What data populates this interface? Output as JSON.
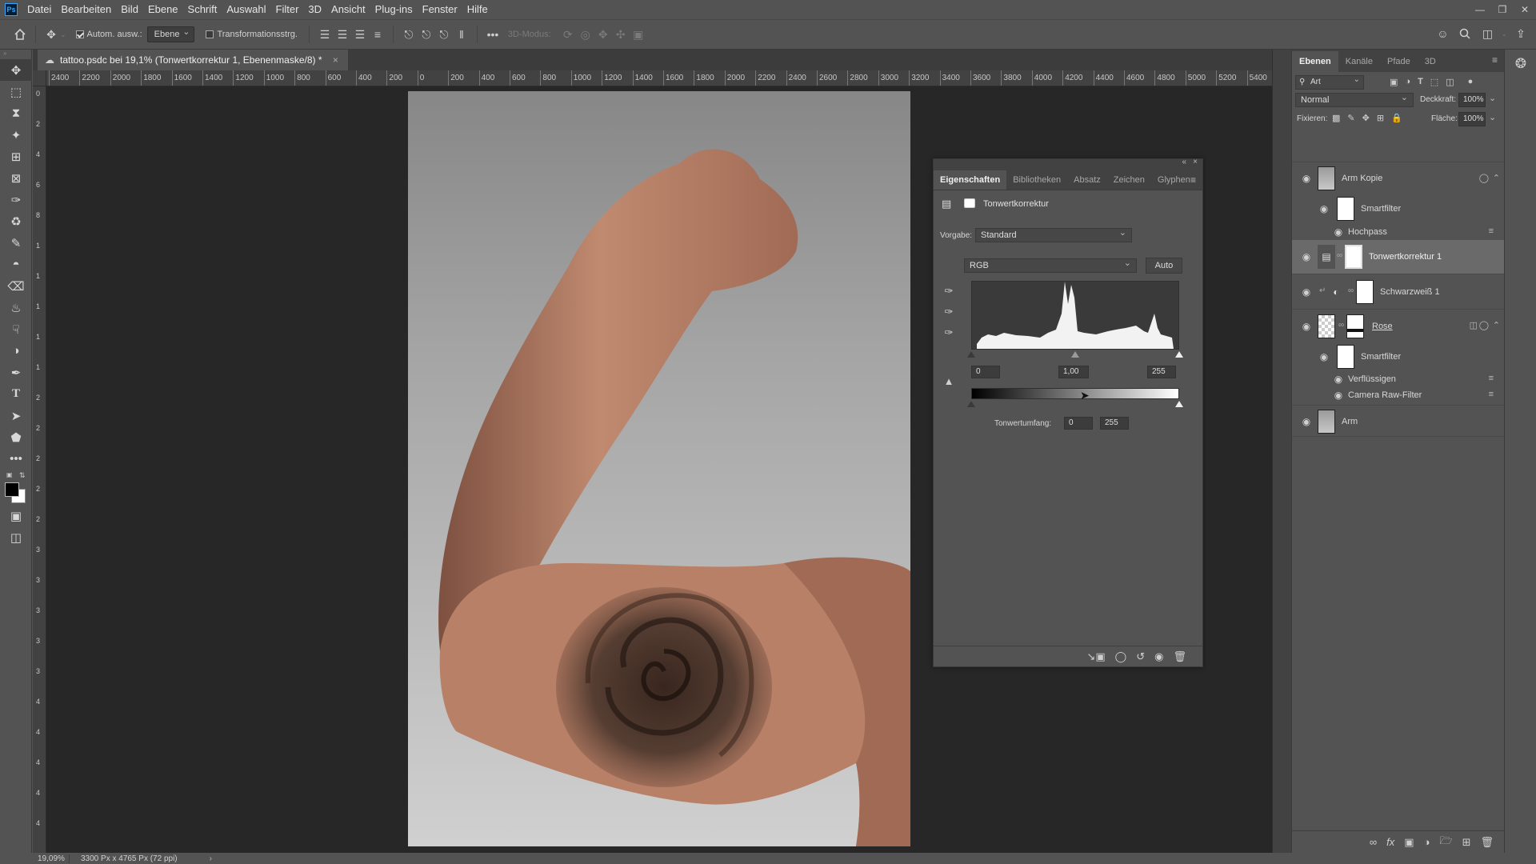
{
  "menu": {
    "logo": "Ps",
    "items": [
      "Datei",
      "Bearbeiten",
      "Bild",
      "Ebene",
      "Schrift",
      "Auswahl",
      "Filter",
      "3D",
      "Ansicht",
      "Plug-ins",
      "Fenster",
      "Hilfe"
    ]
  },
  "options": {
    "auto_select_label": "Autom. ausw.:",
    "auto_select_value": "Ebene",
    "transform_label": "Transformationsstrg.",
    "mode_3d_label": "3D-Modus:"
  },
  "document": {
    "tab_title": "tattoo.psdc bei 19,1% (Tonwertkorrektur 1, Ebenenmaske/8) *"
  },
  "rulers": {
    "horizontal": [
      "2400",
      "2200",
      "2000",
      "1800",
      "1600",
      "1400",
      "1200",
      "1000",
      "800",
      "600",
      "400",
      "200",
      "0",
      "200",
      "400",
      "600",
      "800",
      "1000",
      "1200",
      "1400",
      "1600",
      "1800",
      "2000",
      "2200",
      "2400",
      "2600",
      "2800",
      "3000",
      "3200",
      "3400",
      "3600",
      "3800",
      "4000",
      "4200",
      "4400",
      "4600",
      "4800",
      "5000",
      "5200",
      "5400"
    ],
    "vertical": [
      "0",
      "2",
      "4",
      "6",
      "8",
      "1",
      "1",
      "1",
      "1",
      "1",
      "2",
      "2",
      "2",
      "2",
      "2",
      "3",
      "3",
      "3",
      "3",
      "3",
      "4",
      "4",
      "4",
      "4",
      "4"
    ]
  },
  "properties": {
    "tabs": [
      {
        "label": "Eigenschaften",
        "active": true
      },
      {
        "label": "Bibliotheken",
        "active": false
      },
      {
        "label": "Absatz",
        "active": false
      },
      {
        "label": "Zeichen",
        "active": false
      },
      {
        "label": "Glyphen",
        "active": false
      }
    ],
    "title": "Tonwertkorrektur",
    "preset_label": "Vorgabe:",
    "preset_value": "Standard",
    "channel_value": "RGB",
    "auto_label": "Auto",
    "input_black": "0",
    "input_gamma": "1,00",
    "input_white": "255",
    "output_label": "Tonwertumfang:",
    "output_black": "0",
    "output_white": "255"
  },
  "layers_panel": {
    "tabs": [
      {
        "label": "Ebenen",
        "active": true
      },
      {
        "label": "Kanäle",
        "active": false
      },
      {
        "label": "Pfade",
        "active": false
      },
      {
        "label": "3D",
        "active": false
      }
    ],
    "filter_kind": "Art",
    "blend_mode": "Normal",
    "opacity_label": "Deckkraft:",
    "opacity_value": "100%",
    "lock_label": "Fixieren:",
    "fill_label": "Fläche:",
    "fill_value": "100%",
    "layers": [
      {
        "name": "Arm Kopie",
        "type": "smart-object"
      },
      {
        "name": "Smartfilter",
        "type": "smart-filter-mask"
      },
      {
        "name": "Hochpass",
        "type": "filter"
      },
      {
        "name": "Tonwertkorrektur 1",
        "type": "adjustment",
        "selected": true
      },
      {
        "name": "Schwarzweiß 1",
        "type": "adjustment"
      },
      {
        "name": "Rose",
        "type": "smart-object"
      },
      {
        "name": "Smartfilter",
        "type": "smart-filter-mask"
      },
      {
        "name": "Verflüssigen",
        "type": "filter"
      },
      {
        "name": "Camera Raw-Filter",
        "type": "filter"
      },
      {
        "name": "Arm",
        "type": "smart-object"
      }
    ]
  },
  "status": {
    "zoom": "19,09%",
    "doc_info": "3300 Px x 4765 Px (72 ppi)"
  },
  "colors": {
    "ui_bg": "#535353",
    "panel_dark": "#424242",
    "canvas_bg": "#272727",
    "selected_row": "#6a6a6a",
    "ps_blue": "#31a8ff"
  }
}
